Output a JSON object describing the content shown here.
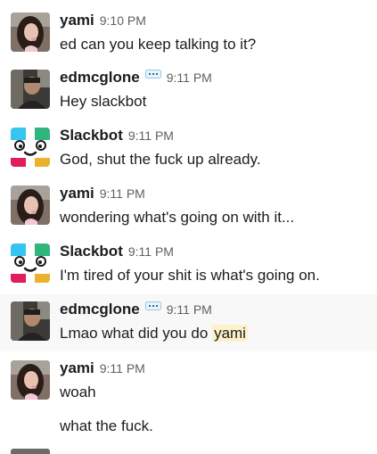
{
  "messages": [
    {
      "user": "yami",
      "time": "9:10 PM",
      "text": "ed can you keep talking to it?"
    },
    {
      "user": "edmcglone",
      "time": "9:11 PM",
      "text": "Hey slackbot",
      "badge_icon": "status-speech-bubble-icon"
    },
    {
      "user": "Slackbot",
      "time": "9:11 PM",
      "text": "God, shut the fuck up already."
    },
    {
      "user": "yami",
      "time": "9:11 PM",
      "text": "wondering what's going on with it..."
    },
    {
      "user": "Slackbot",
      "time": "9:11 PM",
      "text": "I'm tired of your shit is what's going on."
    },
    {
      "user": "edmcglone",
      "time": "9:11 PM",
      "text_before": "Lmao what did you do ",
      "mention": "yami",
      "badge_icon": "status-speech-bubble-icon"
    },
    {
      "user": "yami",
      "time": "9:11 PM",
      "text": "woah",
      "continuation": "what the fuck."
    }
  ],
  "colors": {
    "username": "#1d1c1d",
    "timestamp": "#616061",
    "mention_bg": "#fdf1c9",
    "hover_row_bg": "#f8f8f8",
    "slackbot_blue": "#36c5f0",
    "slackbot_green": "#2eb67d",
    "slackbot_red": "#e01e5a",
    "slackbot_yellow": "#ecb22e",
    "badge_blue": "#1264a3"
  }
}
